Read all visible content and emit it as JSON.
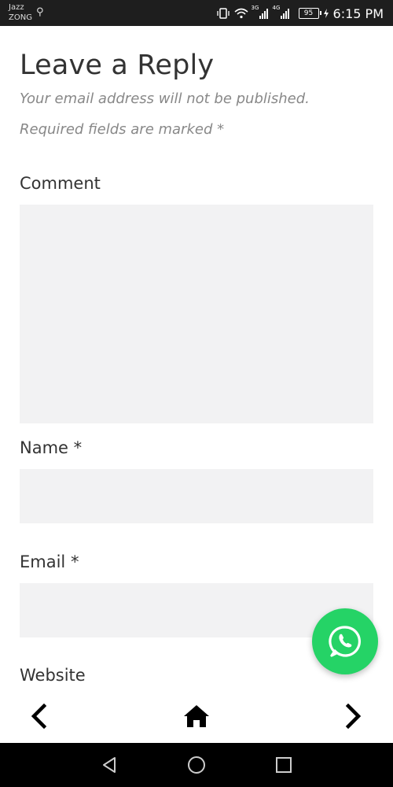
{
  "status_bar": {
    "carrier_1": "Jazz",
    "carrier_2": "ZONG",
    "sig1_tag": "3G",
    "sig2_tag": "4G",
    "battery": "95",
    "time": "6:15 PM"
  },
  "reply": {
    "title": "Leave a Reply",
    "note_email": "Your email address will not be published.",
    "note_required": "Required fields are marked *"
  },
  "form": {
    "comment_label": "Comment",
    "comment_value": "",
    "name_label": "Name *",
    "name_value": "",
    "email_label": "Email *",
    "email_value": "",
    "website_label": "Website"
  },
  "colors": {
    "whatsapp": "#25d366",
    "field_bg": "#f2f2f3",
    "text": "#333333",
    "muted": "#888888"
  }
}
